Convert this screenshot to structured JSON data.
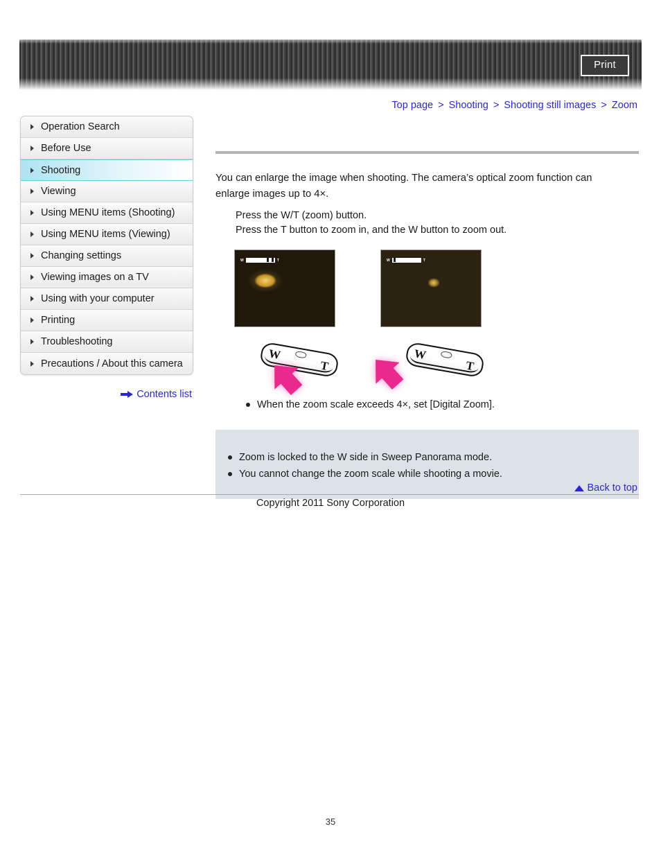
{
  "header": {
    "print_label": "Print"
  },
  "breadcrumb": {
    "items": [
      {
        "label": "Top page"
      },
      {
        "label": "Shooting"
      },
      {
        "label": "Shooting still images"
      },
      {
        "label": "Zoom"
      }
    ],
    "separator": ">"
  },
  "sidebar": {
    "items": [
      {
        "label": "Operation Search",
        "active": false
      },
      {
        "label": "Before Use",
        "active": false
      },
      {
        "label": "Shooting",
        "active": true
      },
      {
        "label": "Viewing",
        "active": false
      },
      {
        "label": "Using MENU items (Shooting)",
        "active": false
      },
      {
        "label": "Using MENU items (Viewing)",
        "active": false
      },
      {
        "label": "Changing settings",
        "active": false
      },
      {
        "label": "Viewing images on a TV",
        "active": false
      },
      {
        "label": "Using with your computer",
        "active": false
      },
      {
        "label": "Printing",
        "active": false
      },
      {
        "label": "Troubleshooting",
        "active": false
      },
      {
        "label": "Precautions / About this camera",
        "active": false
      }
    ],
    "contents_list_label": "Contents list",
    "active_highlight_color": "#aee2f2"
  },
  "main": {
    "intro": "You can enlarge the image when shooting. The camera’s optical zoom function can enlarge images up to 4×.",
    "step_1": "Press the W/T (zoom) button.",
    "step_2": "Press the T button to zoom in, and the W button to zoom out.",
    "figure": {
      "left": {
        "caption_w": "W",
        "caption_t": "T",
        "zoom_state": "telephoto"
      },
      "right": {
        "caption_w": "W",
        "caption_t": "T",
        "zoom_state": "wide"
      },
      "arrow_color": "#ea298f"
    },
    "tip_note": "When the zoom scale exceeds 4×, set [Digital Zoom].",
    "notes": [
      "Zoom is locked to the W side in Sweep Panorama mode.",
      "You cannot change the zoom scale while shooting a movie."
    ],
    "note_box_color": "#dde2e8"
  },
  "footer": {
    "back_to_top_label": "Back to top",
    "copyright": "Copyright 2011 Sony Corporation",
    "page_number": "35"
  }
}
